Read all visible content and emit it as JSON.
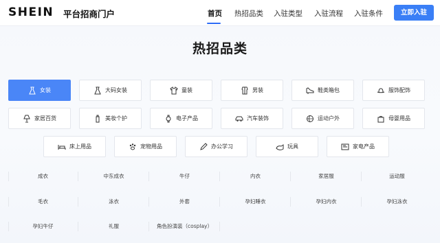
{
  "header": {
    "brand": "SHEIN",
    "portal_title": "平台招商门户",
    "nav": [
      "首页",
      "热招品类",
      "入驻类型",
      "入驻流程",
      "入驻条件"
    ],
    "cta_label": "立即入驻"
  },
  "page_title": "热招品类",
  "categories": [
    {
      "label": "女装",
      "icon": "dress-icon",
      "selected": true
    },
    {
      "label": "大码女装",
      "icon": "plus-size-dress-icon"
    },
    {
      "label": "童装",
      "icon": "kids-shirt-icon"
    },
    {
      "label": "男装",
      "icon": "mens-shirt-icon"
    },
    {
      "label": "鞋类箱包",
      "icon": "heel-shoe-icon"
    },
    {
      "label": "服饰配饰",
      "icon": "hat-icon"
    },
    {
      "label": "家居百货",
      "icon": "lamp-icon"
    },
    {
      "label": "美妆个护",
      "icon": "cosmetics-bottle-icon"
    },
    {
      "label": "电子产品",
      "icon": "watch-icon"
    },
    {
      "label": "汽车装饰",
      "icon": "car-icon"
    },
    {
      "label": "运动户外",
      "icon": "ball-icon"
    },
    {
      "label": "母婴用品",
      "icon": "baby-bag-icon"
    },
    {
      "label": "床上用品",
      "icon": "bed-icon"
    },
    {
      "label": "宠物用品",
      "icon": "paw-icon"
    },
    {
      "label": "办公学习",
      "icon": "pencil-icon"
    },
    {
      "label": "玩具",
      "icon": "toy-icon"
    },
    {
      "label": "家电产品",
      "icon": "appliance-icon"
    }
  ],
  "subcategories": [
    "成衣",
    "中东成衣",
    "牛仔",
    "内衣",
    "家居服",
    "运动服",
    "毛衣",
    "泳衣",
    "外套",
    "孕妇睡衣",
    "孕妇内衣",
    "孕妇泳衣",
    "孕妇牛仔",
    "礼服",
    "角色扮演装（cosplay）"
  ],
  "colors": {
    "accent": "#3a7ff6",
    "selected": "#4a86f7"
  }
}
